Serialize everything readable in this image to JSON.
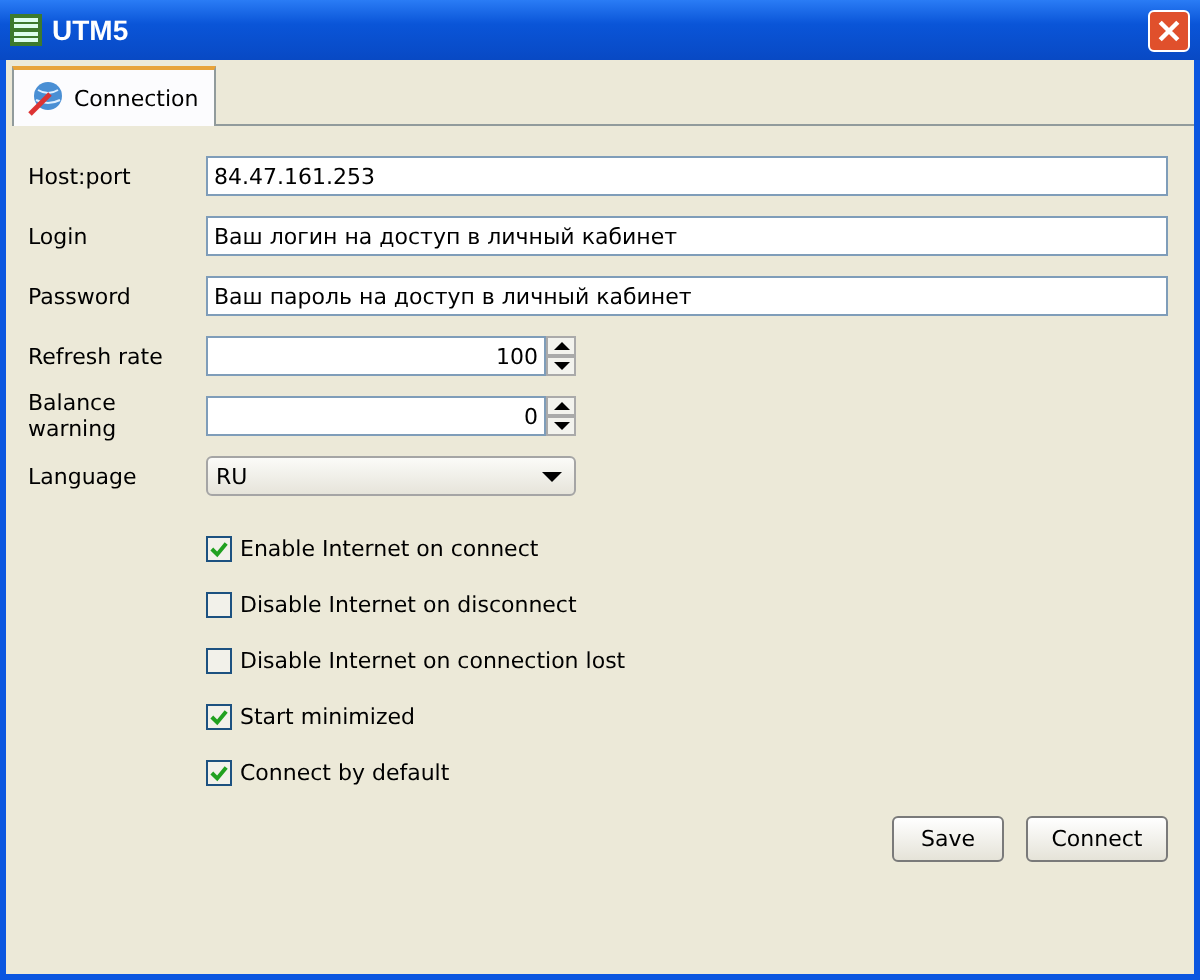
{
  "window": {
    "title": "UTM5"
  },
  "tabs": [
    {
      "label": "Connection",
      "selected": true
    }
  ],
  "fields": [
    {
      "kind": "text",
      "label": "Host:port",
      "value": "84.47.161.253"
    },
    {
      "kind": "text",
      "label": "Login",
      "value": "Ваш логин на доступ в личный кабинет"
    },
    {
      "kind": "text",
      "label": "Password",
      "value": "Ваш пароль на доступ в личный кабинет"
    },
    {
      "kind": "spinner",
      "label": "Refresh rate",
      "value": "100"
    },
    {
      "kind": "spinner",
      "label": "Balance warning",
      "value": "0"
    },
    {
      "kind": "dropdown",
      "label": "Language",
      "value": "RU"
    }
  ],
  "checkboxes": [
    {
      "label": "Enable Internet on connect",
      "checked": true
    },
    {
      "label": "Disable Internet on disconnect",
      "checked": false
    },
    {
      "label": "Disable Internet on connection lost",
      "checked": false
    },
    {
      "label": "Start minimized",
      "checked": true
    },
    {
      "label": "Connect by default",
      "checked": true
    }
  ],
  "buttons": [
    "Save",
    "Connect"
  ]
}
